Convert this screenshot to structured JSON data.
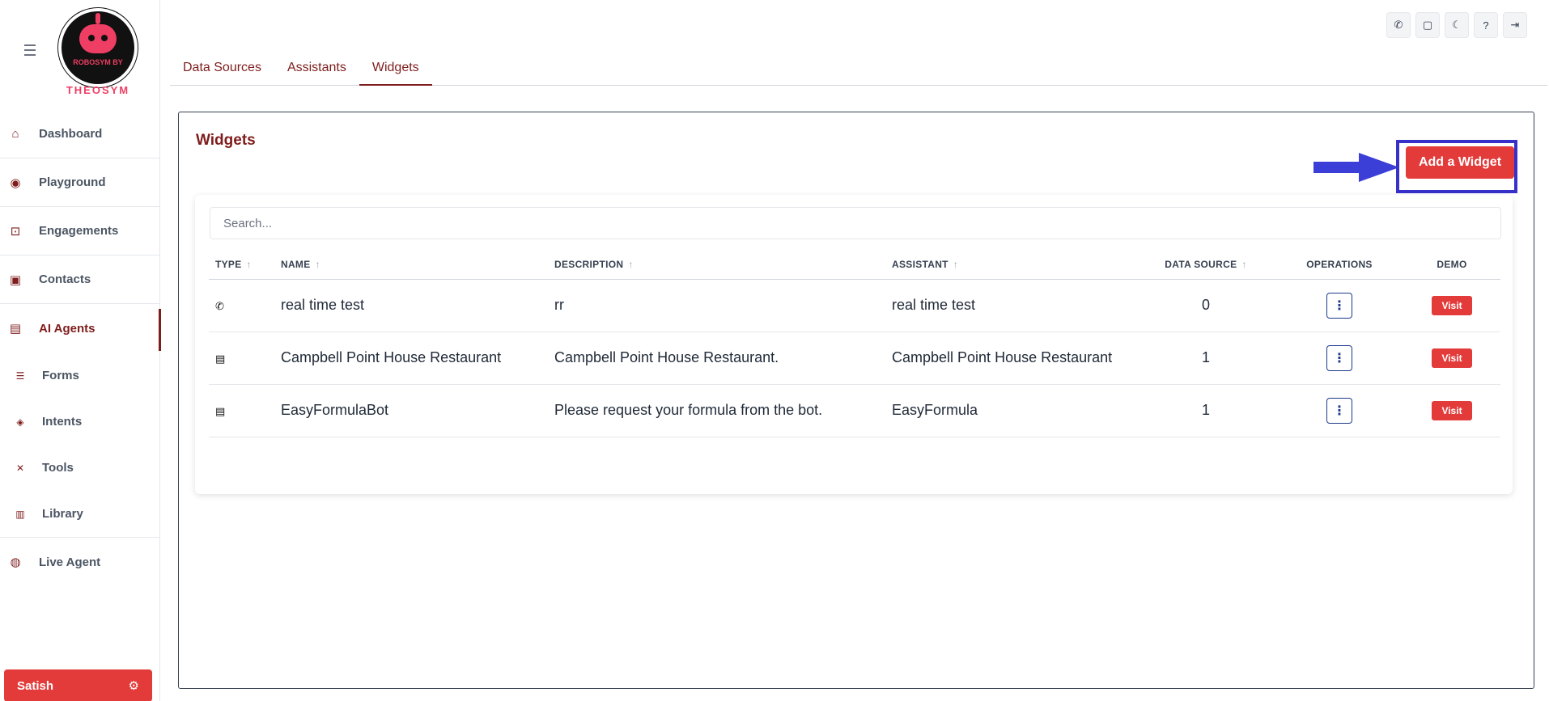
{
  "brand": {
    "logo_text": "ROBOSYM BY",
    "wordmark": "THEOSYM"
  },
  "sidebar": {
    "items": [
      {
        "label": "Dashboard",
        "icon": "home-icon"
      },
      {
        "label": "Playground",
        "icon": "gamepad-icon"
      },
      {
        "label": "Engagements",
        "icon": "activity-icon"
      },
      {
        "label": "Contacts",
        "icon": "contact-icon"
      },
      {
        "label": "AI Agents",
        "icon": "robot-icon"
      }
    ],
    "subitems": [
      {
        "label": "Forms",
        "icon": "list-icon"
      },
      {
        "label": "Intents",
        "icon": "intent-icon"
      },
      {
        "label": "Tools",
        "icon": "tools-icon"
      },
      {
        "label": "Library",
        "icon": "library-icon"
      }
    ],
    "live_agent": {
      "label": "Live Agent",
      "icon": "chat-icon"
    },
    "user": {
      "name": "Satish"
    }
  },
  "tabs": [
    {
      "label": "Data Sources"
    },
    {
      "label": "Assistants"
    },
    {
      "label": "Widgets"
    }
  ],
  "panel": {
    "title": "Widgets",
    "add_button": "Add a Widget",
    "search_placeholder": "Search..."
  },
  "table": {
    "headers": {
      "type": "TYPE",
      "name": "NAME",
      "description": "DESCRIPTION",
      "assistant": "ASSISTANT",
      "data_source": "DATA SOURCE",
      "operations": "OPERATIONS",
      "demo": "DEMO"
    },
    "rows": [
      {
        "type_icon": "phone-icon",
        "name": "real time test",
        "description": "rr",
        "assistant": "real time test",
        "data_source": "0",
        "visit": "Visit"
      },
      {
        "type_icon": "html-file-icon",
        "name": "Campbell Point House Restaurant",
        "description": "Campbell Point House Restaurant.",
        "assistant": "Campbell Point House Restaurant",
        "data_source": "1",
        "visit": "Visit"
      },
      {
        "type_icon": "html-file-icon",
        "name": "EasyFormulaBot",
        "description": "Please request your formula from the bot.",
        "assistant": "EasyFormula",
        "data_source": "1",
        "visit": "Visit"
      }
    ]
  },
  "colors": {
    "accent": "#e33a3a",
    "brand_dark": "#7f1d1d",
    "highlight": "#3730c9"
  }
}
